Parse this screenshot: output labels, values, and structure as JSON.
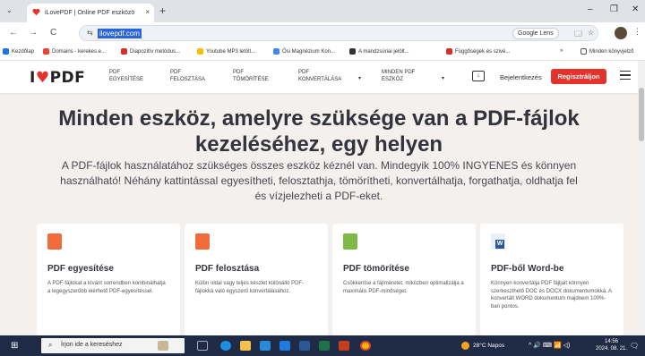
{
  "browser": {
    "tab_title": "iLovePDF | Online PDF eszközö",
    "tab_close": "×",
    "new_tab": "+",
    "tab_menu": "⌄",
    "minimize": "–",
    "maximize": "❐",
    "close": "✕",
    "back": "←",
    "forward": "→",
    "reload": "C",
    "site_info": "⇆",
    "url": "ilovepdf.com",
    "google_lens": "Google Lens",
    "translate": "🗔",
    "star": "☆",
    "menu": "⋮",
    "bookmarks_more": "»"
  },
  "bookmarks": [
    {
      "label": "Kezdőlap",
      "color": "#1a73e8"
    },
    {
      "label": "Domains - kerekes.e...",
      "color": "#ea4335"
    },
    {
      "label": "Diapozitív metódus...",
      "color": "#d93025"
    },
    {
      "label": "Youtube MP3 letölt...",
      "color": "#fbbc05"
    },
    {
      "label": "Ősi Magnézium Kon...",
      "color": "#4285f4"
    },
    {
      "label": "A mandzsúriai jelölt...",
      "color": "#333333"
    },
    {
      "label": "Függőségek és szivé...",
      "color": "#d93025"
    },
    {
      "label": "Minden könyvjelző",
      "color": "#555555"
    }
  ],
  "site": {
    "logo_prefix": "I",
    "logo_heart": "♥",
    "logo_suffix": "PDF",
    "nav": [
      {
        "line1": "PDF",
        "line2": "EGYESÍTÉSE"
      },
      {
        "line1": "PDF",
        "line2": "FELOSZTÁSA"
      },
      {
        "line1": "PDF",
        "line2": "TÖMÖRÍTÉSE"
      },
      {
        "line1": "PDF",
        "line2": "KONVERTÁLÁSA"
      },
      {
        "line1": "MINDEN PDF",
        "line2": "ESZKÖZ"
      }
    ],
    "nav_caret": "▾",
    "download_icon": "↓",
    "login": "Bejelentkezés",
    "signup": "Regisztráljon"
  },
  "hero": {
    "title": "Minden eszköz, amelyre szüksége van a PDF-fájlok kezeléséhez, egy helyen",
    "subtitle": "A PDF-fájlok használatához szükséges összes eszköz kéznél van. Mindegyik 100% INGYENES és könnyen használható! Néhány kattintással egyesítheti, felosztathja, tömörítheti, konvertálhatja, forgathatja, oldhatja fel és vízjelezheti a PDF-eket."
  },
  "cards": [
    {
      "title": "PDF egyesítése",
      "desc": "A PDF-fájlokat a kívánt sorrendben kombinálhatja a legegyszerűbb elérhető PDF-egyesítéssel."
    },
    {
      "title": "PDF felosztása",
      "desc": "Külön oldal vagy teljes készlet különálló PDF-fájlokká való egyszerű konvertálásához."
    },
    {
      "title": "PDF tömörítése",
      "desc": "Csökkentse a fájlméretet, miközben optimalizálja a maximális PDF-minőséget."
    },
    {
      "title": "PDF-ből Word-be",
      "desc": "Könnyen konvertálja PDF fájljait könnyen szerkeszthető DOC és DOCX dokumentumokká. A konvertált WORD dokumentum majdnem 100%-ban pontos."
    }
  ],
  "word_letter": "W",
  "taskbar": {
    "start": "⊞",
    "search_icon": "⌕",
    "search_placeholder": "Írjon ide a kereséshez",
    "weather": "28°C Napos",
    "tray": "^ 🔊 ⌨ 📶 ◁)",
    "time": "14:56",
    "date": "2024. 08. 21.",
    "notifications": "🗨"
  },
  "colors": {
    "brand_red": "#e5322d",
    "taskbar": "#1f2a44"
  }
}
